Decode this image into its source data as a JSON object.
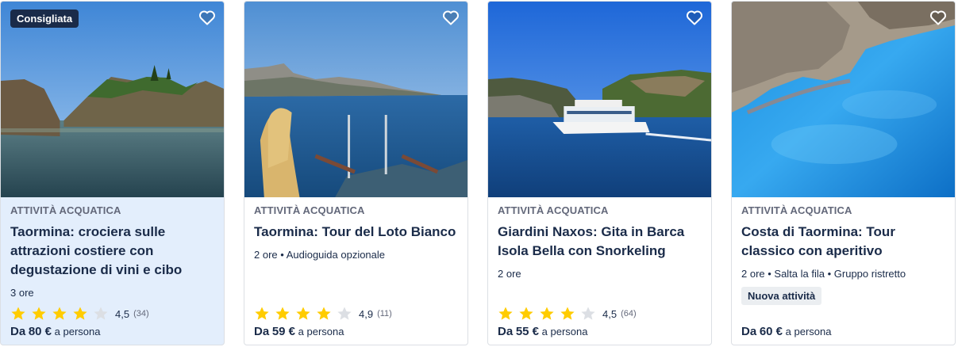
{
  "cards": [
    {
      "badge": "Consigliata",
      "category": "ATTIVITÀ ACQUATICA",
      "title": "Taormina: crociera sulle attrazioni costiere con degustazione di vini e cibo",
      "meta": "3 ore",
      "tag": "",
      "rating": 4.5,
      "rating_label": "4,5",
      "reviews": "(34)",
      "price_from": "Da",
      "price_amount": "80 €",
      "price_suffix": "a persona",
      "favorite_icon": "heart-outline-icon"
    },
    {
      "badge": "",
      "category": "ATTIVITÀ ACQUATICA",
      "title": "Taormina: Tour del Loto Bianco",
      "meta": "2 ore • Audioguida opzionale",
      "tag": "",
      "rating": 4.9,
      "rating_label": "4,9",
      "reviews": "(11)",
      "price_from": "Da",
      "price_amount": "59 €",
      "price_suffix": "a persona",
      "favorite_icon": "heart-outline-icon"
    },
    {
      "badge": "",
      "category": "ATTIVITÀ ACQUATICA",
      "title": "Giardini Naxos: Gita in Barca Isola Bella con Snorkeling",
      "meta": "2 ore",
      "tag": "",
      "rating": 4.5,
      "rating_label": "4,5",
      "reviews": "(64)",
      "price_from": "Da",
      "price_amount": "55 €",
      "price_suffix": "a persona",
      "favorite_icon": "heart-outline-icon"
    },
    {
      "badge": "",
      "category": "ATTIVITÀ ACQUATICA",
      "title": "Costa di Taormina: Tour classico con aperitivo",
      "meta": "2 ore • Salta la fila • Gruppo ristretto",
      "tag": "Nuova attività",
      "rating": null,
      "rating_label": "",
      "reviews": "",
      "price_from": "Da",
      "price_amount": "60 €",
      "price_suffix": "a persona",
      "favorite_icon": "heart-outline-icon"
    }
  ],
  "colors": {
    "star_filled": "#ffcc00",
    "star_empty": "#dcdfe4",
    "badge_bg": "#1a2b49",
    "highlight_bg": "#e3eefc",
    "text": "#1a2b49"
  }
}
